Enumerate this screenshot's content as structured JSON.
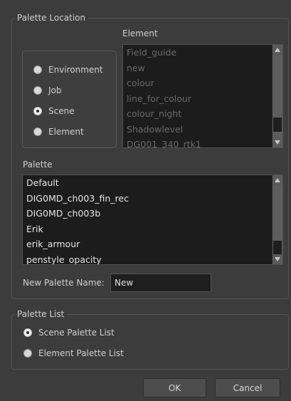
{
  "palette_location": {
    "title": "Palette Location",
    "options": [
      {
        "label": "Environment",
        "checked": false
      },
      {
        "label": "Job",
        "checked": false
      },
      {
        "label": "Scene",
        "checked": true
      },
      {
        "label": "Element",
        "checked": false
      }
    ],
    "element_label": "Element",
    "element_list": [
      "Field_guide",
      "new",
      "colour",
      "line_for_colour",
      "colour_night",
      "Shadowlevel",
      "DG001_340_rtk1"
    ],
    "palette_label": "Palette",
    "palette_list": [
      "Default",
      "DIG0MD_ch003_fin_rec",
      "DIG0MD_ch003b",
      "Erik",
      "erik_armour",
      "penstyle_opacity"
    ],
    "new_palette_name_label": "New Palette Name:",
    "new_palette_name_value": "New"
  },
  "palette_list": {
    "title": "Palette List",
    "options": [
      {
        "label": "Scene Palette List",
        "checked": true
      },
      {
        "label": "Element Palette List",
        "checked": false
      }
    ]
  },
  "buttons": {
    "ok": "OK",
    "cancel": "Cancel"
  },
  "icons": {
    "scroll_up": "triangle-up-icon",
    "scroll_down": "triangle-down-icon"
  }
}
